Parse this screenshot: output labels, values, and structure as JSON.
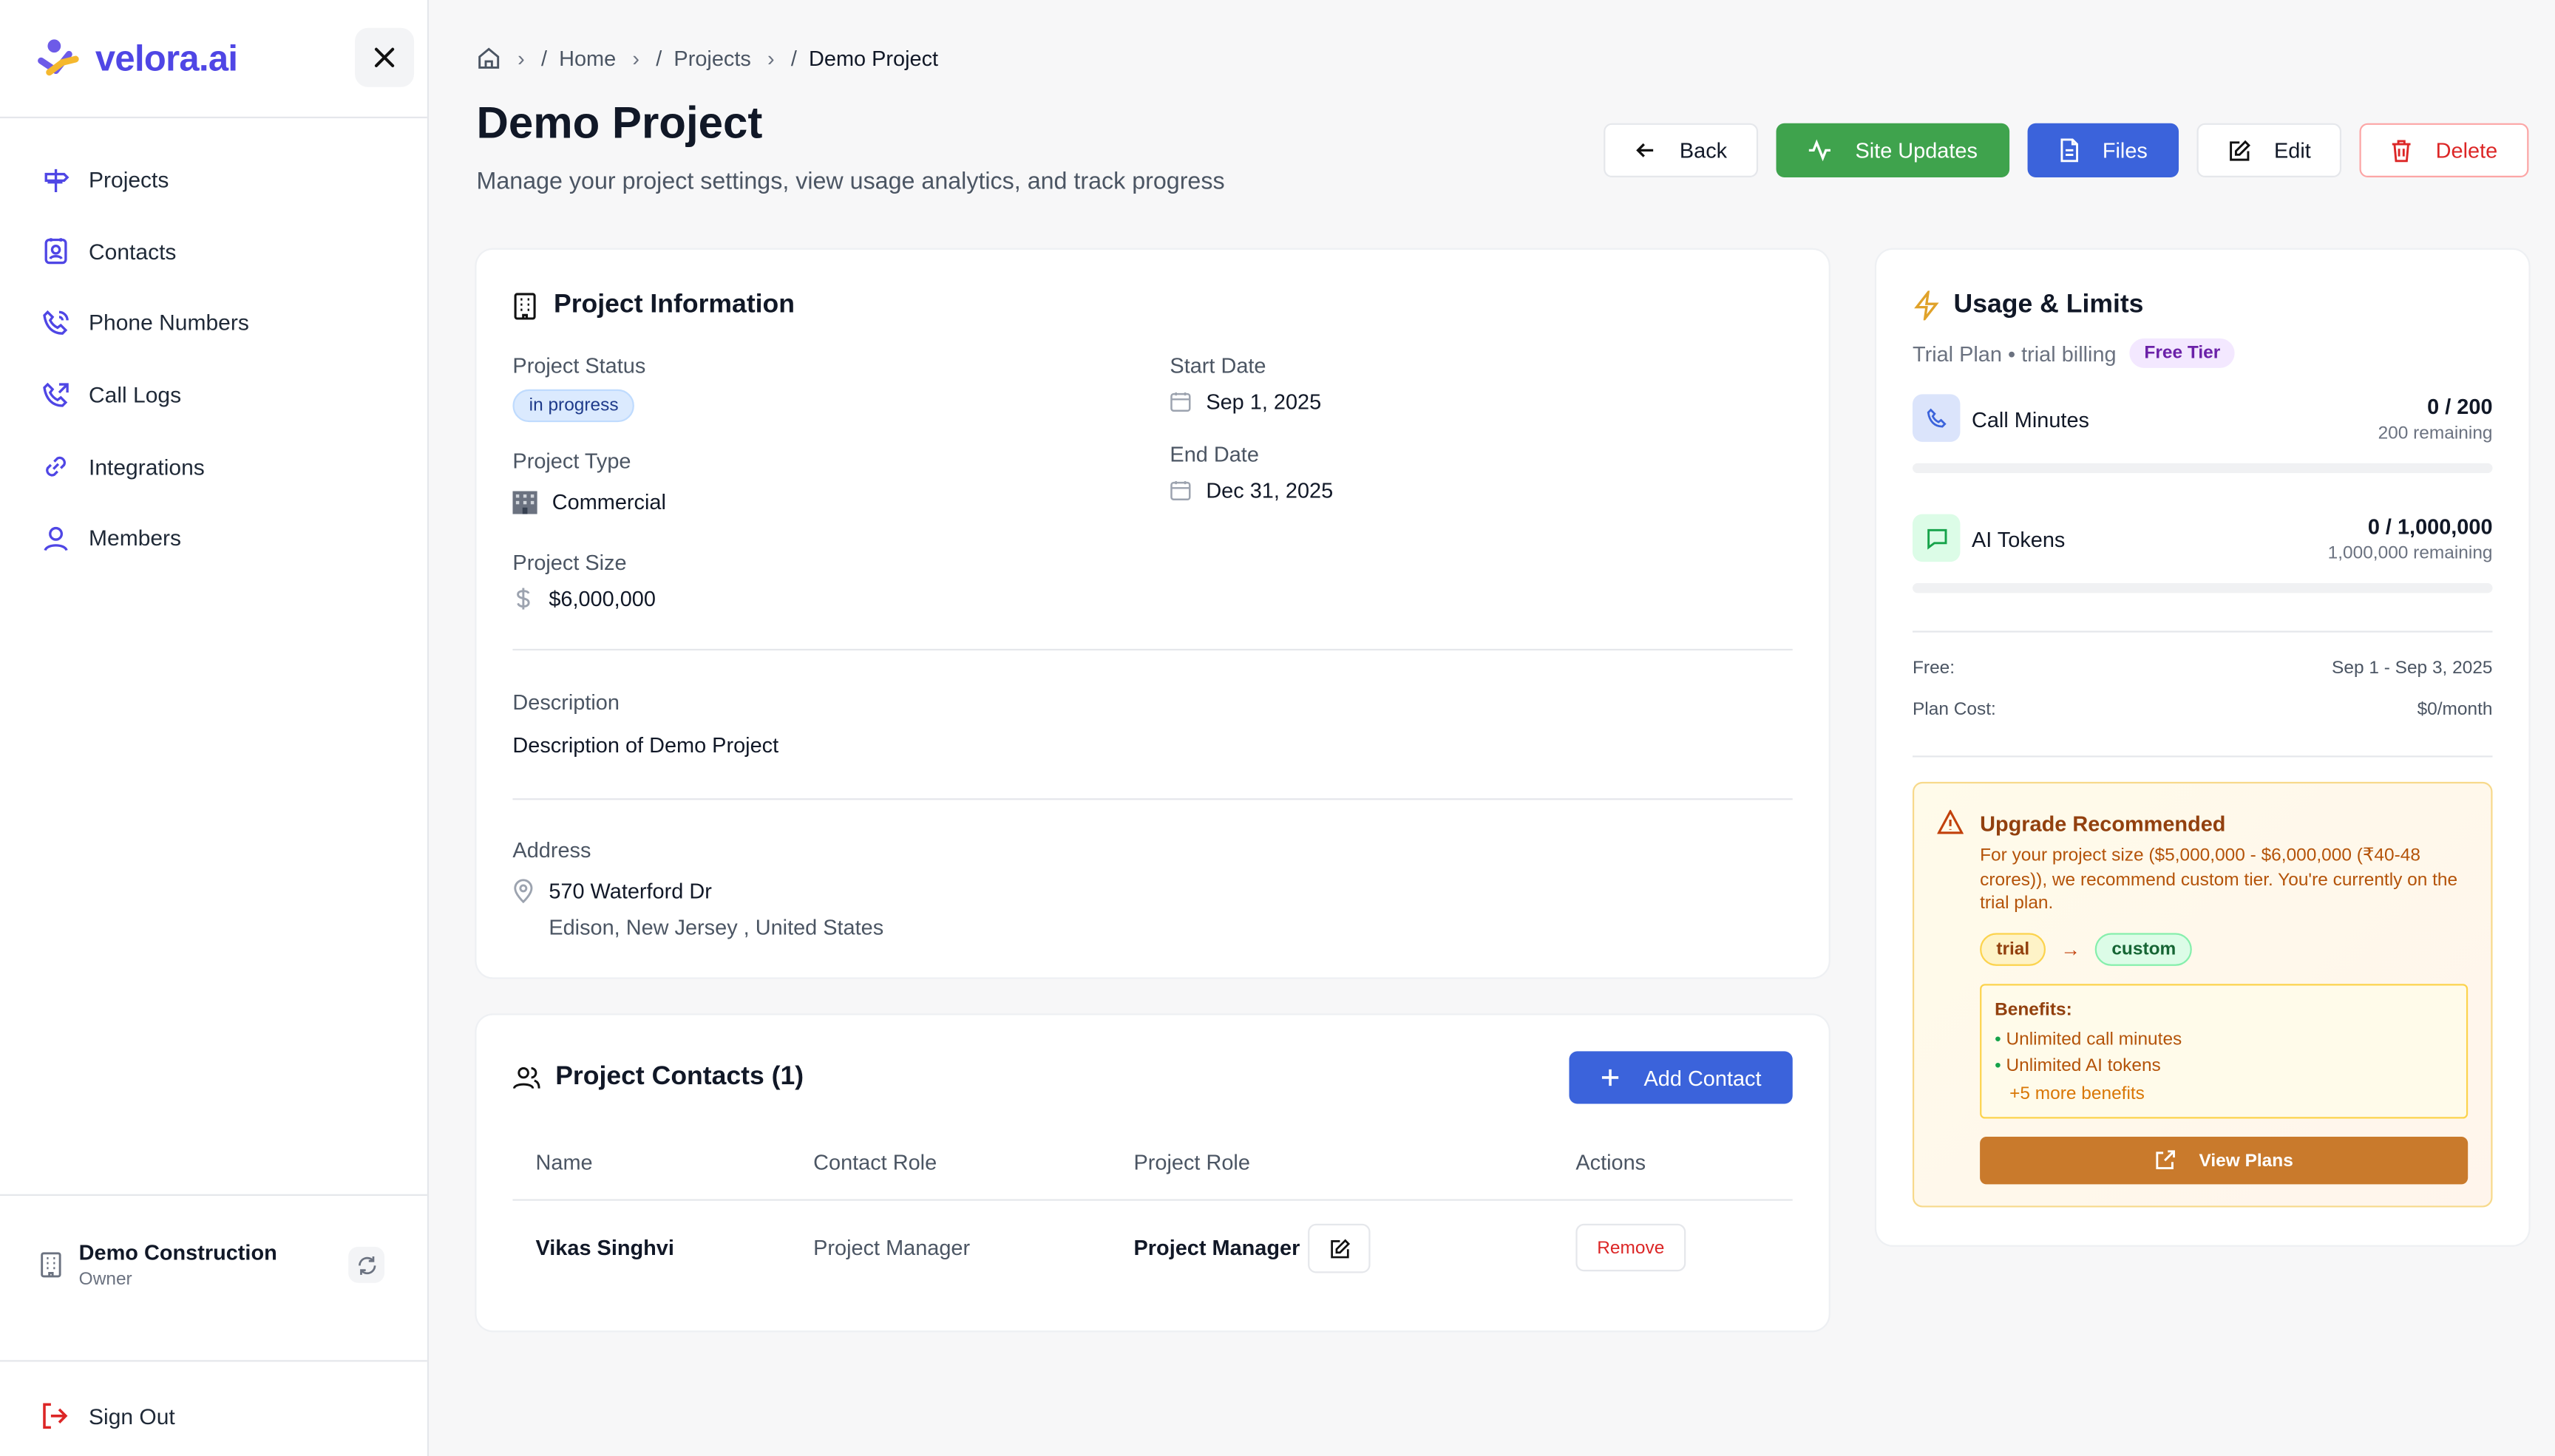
{
  "brand": {
    "name": "velora.ai"
  },
  "sidebar": {
    "items": [
      {
        "label": "Projects",
        "icon": "signpost-icon"
      },
      {
        "label": "Contacts",
        "icon": "contact-card-icon"
      },
      {
        "label": "Phone Numbers",
        "icon": "phone-icon"
      },
      {
        "label": "Call Logs",
        "icon": "phone-log-icon"
      },
      {
        "label": "Integrations",
        "icon": "link-icon"
      },
      {
        "label": "Members",
        "icon": "user-icon"
      }
    ],
    "org": {
      "name": "Demo Construction",
      "role": "Owner"
    },
    "sign_out": "Sign Out"
  },
  "breadcrumb": {
    "home": "Home",
    "projects": "Projects",
    "current": "Demo Project",
    "slash": "/"
  },
  "header": {
    "title": "Demo Project",
    "subtitle": "Manage your project settings, view usage analytics, and track progress",
    "buttons": {
      "back": "Back",
      "site_updates": "Site Updates",
      "files": "Files",
      "edit": "Edit",
      "delete": "Delete"
    }
  },
  "project_info": {
    "title": "Project Information",
    "status_label": "Project Status",
    "status_value": "in progress",
    "type_label": "Project Type",
    "type_value": "Commercial",
    "size_label": "Project Size",
    "size_value": "$6,000,000",
    "start_label": "Start Date",
    "start_value": "Sep 1, 2025",
    "end_label": "End Date",
    "end_value": "Dec 31, 2025",
    "description_label": "Description",
    "description_value": "Description of Demo Project",
    "address_label": "Address",
    "address_line1": "570 Waterford Dr",
    "address_line2": "Edison, New Jersey , United States"
  },
  "contacts": {
    "title": "Project Contacts (1)",
    "add_label": "Add Contact",
    "columns": [
      "Name",
      "Contact Role",
      "Project Role",
      "Actions"
    ],
    "rows": [
      {
        "name": "Vikas Singhvi",
        "contact_role": "Project Manager",
        "project_role": "Project Manager",
        "action": "Remove"
      }
    ]
  },
  "usage": {
    "title": "Usage & Limits",
    "plan_text": "Trial Plan • trial billing",
    "tier_badge": "Free Tier",
    "call_minutes": {
      "label": "Call Minutes",
      "value": "0 / 200",
      "remaining": "200 remaining",
      "fraction": 0
    },
    "ai_tokens": {
      "label": "AI Tokens",
      "value": "0 / 1,000,000",
      "remaining": "1,000,000 remaining",
      "fraction": 0
    },
    "free_label": "Free:",
    "free_value": "Sep 1 - Sep 3, 2025",
    "cost_label": "Plan Cost:",
    "cost_value": "$0/month",
    "upgrade": {
      "title": "Upgrade Recommended",
      "text": "For your project size ($5,000,000 - $6,000,000 (₹40-48 crores)), we recommend custom tier. You're currently on the trial plan.",
      "from_tier": "trial",
      "to_tier": "custom",
      "arrow": "→",
      "benefits_title": "Benefits:",
      "benefits": [
        "Unlimited call minutes",
        "Unlimited AI tokens"
      ],
      "more": "+5 more benefits",
      "view_plans": "View Plans"
    }
  },
  "colors": {
    "accent": "#3b63db",
    "green": "#3fa34d",
    "danger": "#dc2626",
    "upgrade": "#c97a2c"
  }
}
